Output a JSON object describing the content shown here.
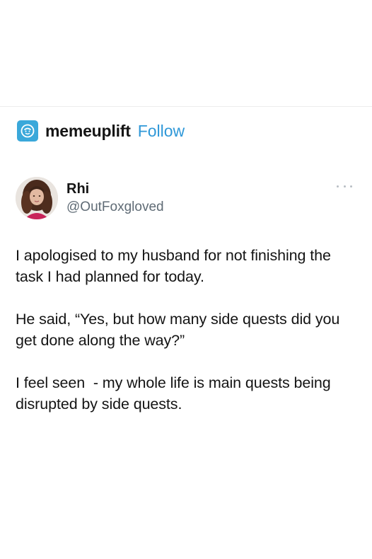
{
  "account": {
    "name": "memeuplift",
    "follow_label": "Follow",
    "icon": "memeuplift-logo-icon",
    "accent_color": "#3aa8da",
    "link_color": "#2f98d8"
  },
  "tweet": {
    "author_name": "Rhi",
    "author_handle": "@OutFoxgloved",
    "avatar_icon": "profile-photo",
    "more_icon": "ellipsis-icon",
    "paragraphs": [
      "I apologised to my husband for not finishing the task I had planned for today.",
      "He said, “Yes, but how many side quests did you get done along the way?”",
      "I feel seen  - my whole life is main quests being disrupted by side quests."
    ]
  }
}
